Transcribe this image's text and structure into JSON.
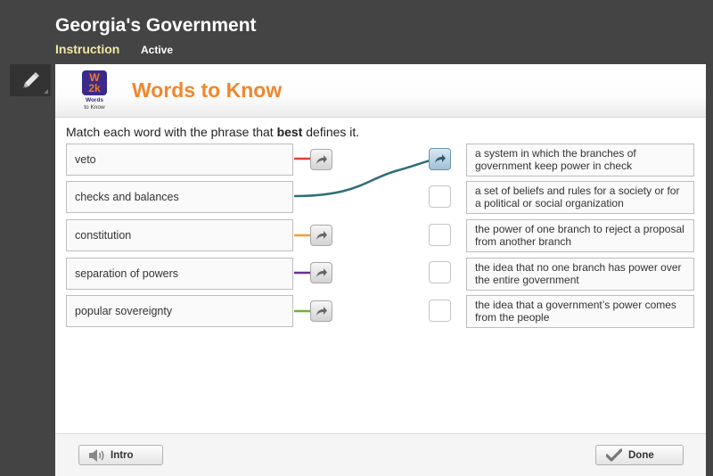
{
  "header": {
    "title": "Georgia's Government",
    "tabs": [
      {
        "label": "Instruction"
      },
      {
        "label": "Active"
      }
    ]
  },
  "toolbar": {
    "tool_icon": "pencil-icon"
  },
  "activity": {
    "logo": {
      "line1": "W",
      "line2": "2k",
      "caption_top": "Words",
      "caption_bottom": "to Know"
    },
    "title": "Words to Know",
    "instructions": {
      "before": "Match each word with the phrase that ",
      "bold": "best",
      "after": " defines it."
    },
    "terms": [
      {
        "label": "veto",
        "connector_color": "#e0403a",
        "matched_to": null
      },
      {
        "label": "checks and balances",
        "connector_color": "#2f6e78",
        "matched_to": 0
      },
      {
        "label": "constitution",
        "connector_color": "#f0a030",
        "matched_to": null
      },
      {
        "label": "separation of powers",
        "connector_color": "#6a2e9a",
        "matched_to": null
      },
      {
        "label": "popular sovereignty",
        "connector_color": "#6fb040",
        "matched_to": null
      }
    ],
    "definitions": [
      {
        "text": "a system in which the branches of government keep power in check",
        "filled": true
      },
      {
        "text": "a set of beliefs and rules for a society or for a political or social organization",
        "filled": false
      },
      {
        "text": "the power of one branch to reject a proposal from another branch",
        "filled": false
      },
      {
        "text": "the idea that no one branch has power over the entire government",
        "filled": false
      },
      {
        "text": "the idea that a government’s power comes from the people",
        "filled": false
      }
    ]
  },
  "footer": {
    "intro_label": "Intro",
    "intro_icon": "speaker-icon",
    "done_label": "Done",
    "done_icon": "checkmark-icon"
  }
}
